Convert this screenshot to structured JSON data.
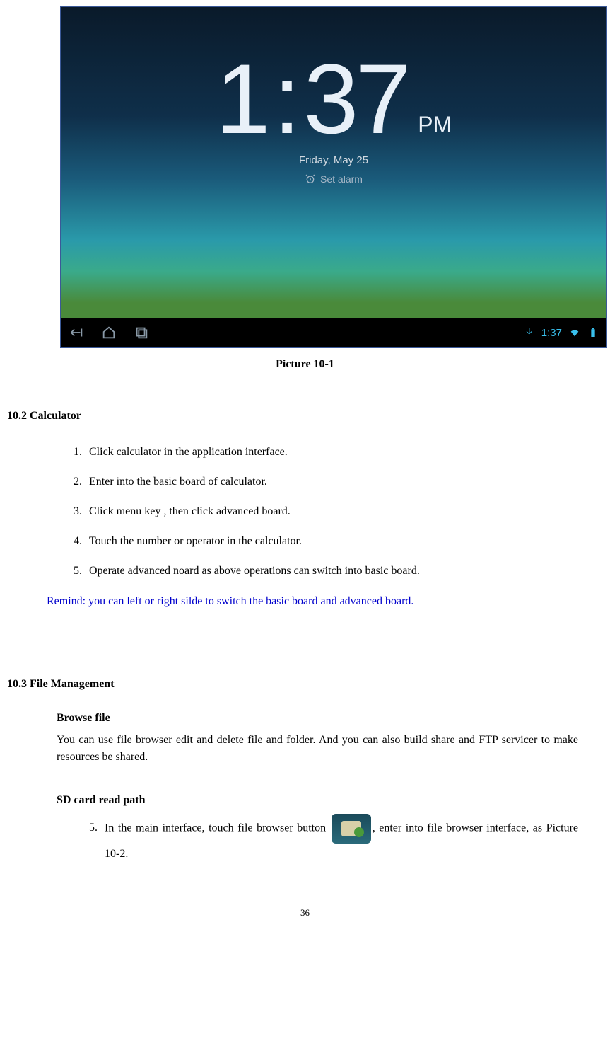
{
  "screenshot": {
    "clock": {
      "hour": "1",
      "colon": ":",
      "minute": "37",
      "ampm": "PM",
      "date": "Friday, May 25",
      "set_alarm": "Set alarm"
    },
    "navbar": {
      "time": "1:37"
    }
  },
  "figure_caption": "Picture 10-1",
  "section_102": {
    "heading": "10.2 Calculator",
    "items": [
      "Click calculator in the application interface.",
      "Enter into the basic board of calculator.",
      "Click menu key , then click advanced board.",
      "Touch the number or operator in the calculator.",
      "Operate advanced noard as above operations can switch into basic board."
    ],
    "remind": "Remind: you can left or right silde to switch the basic board and advanced board."
  },
  "section_103": {
    "heading": "10.3 File Management",
    "browse": {
      "title": "Browse file",
      "body": "You can use file browser edit and delete file and folder. And you can also build share and FTP servicer to make resources be shared."
    },
    "sdcard": {
      "title": "SD card read path",
      "item_number": "5.",
      "item_text_a": "In the main interface, touch file browser button ",
      "item_text_b": ", enter into file browser interface, as Picture 10-2."
    }
  },
  "page_number": "36"
}
